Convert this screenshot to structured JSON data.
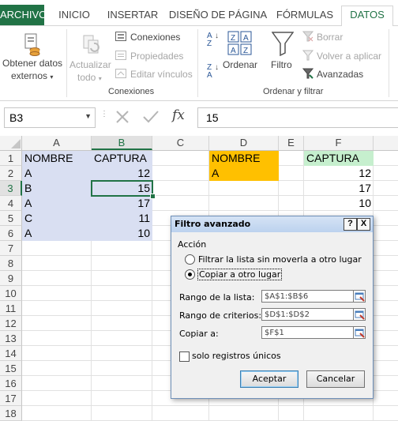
{
  "ribbon_tabs": {
    "archivo": "ARCHIVO",
    "inicio": "INICIO",
    "insertar": "INSERTAR",
    "diseno": "DISEÑO DE PÁGINA",
    "formulas": "FÓRMULAS",
    "datos": "DATOS"
  },
  "ribbon": {
    "obtener_line1": "Obtener datos",
    "obtener_line2": "externos",
    "actualizar_line1": "Actualizar",
    "actualizar_line2": "todo",
    "conexiones": "Conexiones",
    "propiedades": "Propiedades",
    "editar_vinculos": "Editar vínculos",
    "group_conexiones": "Conexiones",
    "ordenar": "Ordenar",
    "filtro": "Filtro",
    "borrar": "Borrar",
    "volver_aplicar": "Volver a aplicar",
    "avanzadas": "Avanzadas",
    "group_ordenar_filtrar": "Ordenar y filtrar",
    "sort_az_top": "A",
    "sort_az_bottom": "Z",
    "sort_za_top": "Z",
    "sort_za_bottom": "A",
    "accent": "#217346"
  },
  "formula_bar": {
    "name_box": "B3",
    "fx": "fx",
    "value": "15"
  },
  "grid": {
    "columns": [
      "A",
      "B",
      "C",
      "D",
      "E",
      "F"
    ],
    "rows": [
      "1",
      "2",
      "3",
      "4",
      "5",
      "6",
      "7",
      "8",
      "9",
      "10",
      "11",
      "12",
      "13",
      "14",
      "15",
      "16",
      "17",
      "18"
    ],
    "a": [
      "NOMBRE",
      "A",
      "B",
      "A",
      "C",
      "A"
    ],
    "b": [
      "CAPTURA",
      "12",
      "15",
      "17",
      "11",
      "10"
    ],
    "d": [
      "NOMBRE",
      "A"
    ],
    "f": [
      "CAPTURA",
      "12",
      "17",
      "10"
    ],
    "selection_fill": "#d9dff2",
    "criteria_fill": "#ffc000",
    "output_header_fill": "#c6efce"
  },
  "dialog": {
    "title": "Filtro avanzado",
    "help": "?",
    "close": "X",
    "accion_label": "Acción",
    "opt_filter": "Filtrar la lista sin moverla a otro lugar",
    "opt_copy": "Copiar a otro lugar",
    "rango_lista_label": "Rango de la lista:",
    "rango_lista_value": "$A$1:$B$6",
    "rango_criterios_label": "Rango de criterios:",
    "rango_criterios_value": "$D$1:$D$2",
    "copiar_a_label": "Copiar a:",
    "copiar_a_value": "$F$1",
    "unicos_label": "solo registros únicos",
    "aceptar": "Aceptar",
    "cancelar": "Cancelar"
  }
}
